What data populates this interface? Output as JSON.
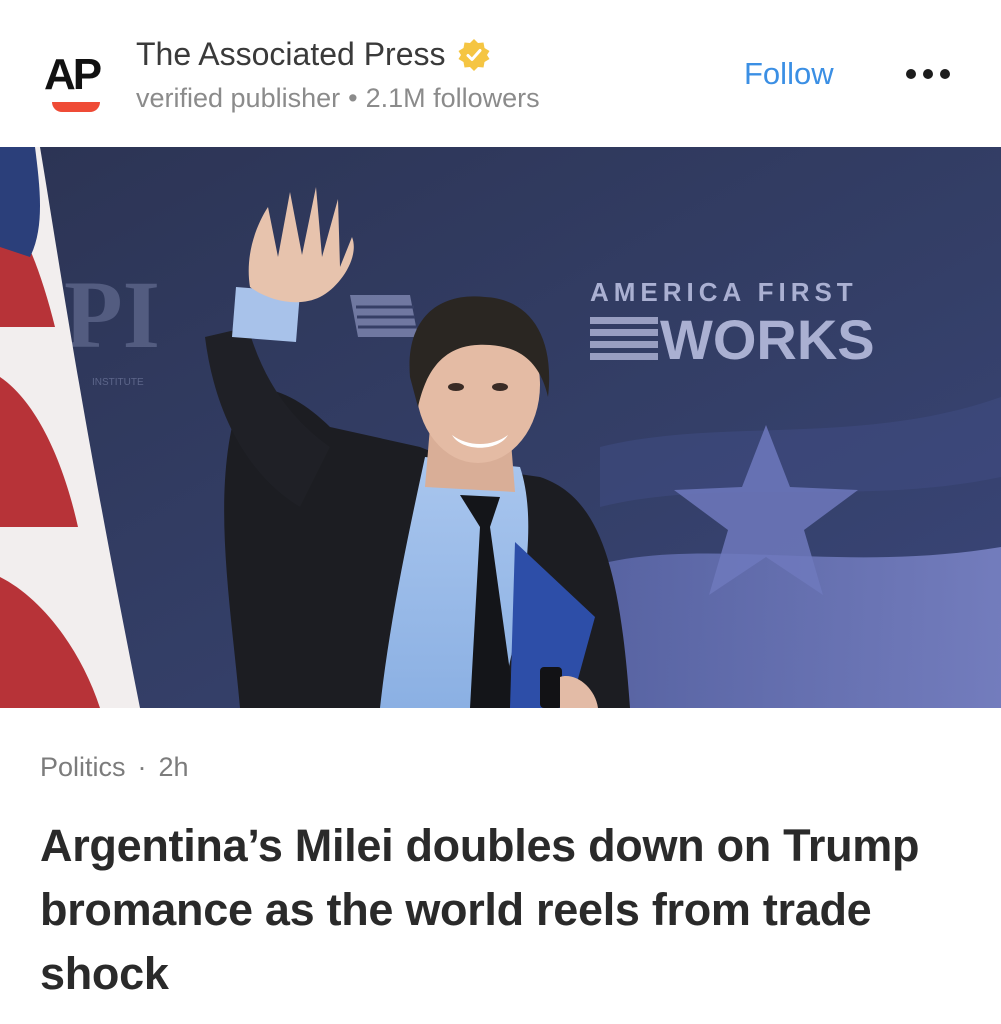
{
  "publisher": {
    "logo_text": "AP",
    "name": "The Associated Press",
    "badge_label": "verified publisher",
    "separator": "•",
    "followers": "2.1M followers",
    "verified_icon": "verified-badge-icon",
    "logo_color": "#ef4b36"
  },
  "actions": {
    "follow_label": "Follow",
    "follow_color": "#3b8fe4",
    "more_icon": "more-options-icon"
  },
  "photo": {
    "backdrop_top_text": "AMERICA FIRST",
    "backdrop_main_text": "WORKS",
    "backdrop_left_text": "PI",
    "backdrop_small_text": "INSTITUTE"
  },
  "article": {
    "category": "Politics",
    "dot": "·",
    "age": "2h",
    "headline": "Argentina’s Milei doubles down on Trump bromance as the world reels from trade shock"
  }
}
